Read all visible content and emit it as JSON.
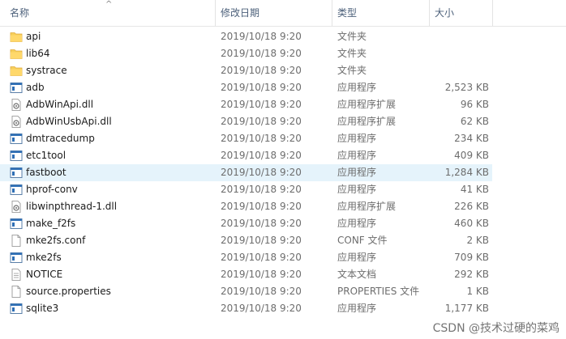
{
  "header": {
    "name": "名称",
    "date": "修改日期",
    "type": "类型",
    "size": "大小",
    "sort_arrow": "^"
  },
  "rows": [
    {
      "name": "api",
      "date": "2019/10/18 9:20",
      "type": "文件夹",
      "size": "",
      "icon": "folder-icon"
    },
    {
      "name": "lib64",
      "date": "2019/10/18 9:20",
      "type": "文件夹",
      "size": "",
      "icon": "folder-icon"
    },
    {
      "name": "systrace",
      "date": "2019/10/18 9:20",
      "type": "文件夹",
      "size": "",
      "icon": "folder-icon"
    },
    {
      "name": "adb",
      "date": "2019/10/18 9:20",
      "type": "应用程序",
      "size": "2,523 KB",
      "icon": "application-icon"
    },
    {
      "name": "AdbWinApi.dll",
      "date": "2019/10/18 9:20",
      "type": "应用程序扩展",
      "size": "96 KB",
      "icon": "dll-icon"
    },
    {
      "name": "AdbWinUsbApi.dll",
      "date": "2019/10/18 9:20",
      "type": "应用程序扩展",
      "size": "62 KB",
      "icon": "dll-icon"
    },
    {
      "name": "dmtracedump",
      "date": "2019/10/18 9:20",
      "type": "应用程序",
      "size": "234 KB",
      "icon": "application-icon"
    },
    {
      "name": "etc1tool",
      "date": "2019/10/18 9:20",
      "type": "应用程序",
      "size": "409 KB",
      "icon": "application-icon"
    },
    {
      "name": "fastboot",
      "date": "2019/10/18 9:20",
      "type": "应用程序",
      "size": "1,284 KB",
      "icon": "application-icon",
      "selected": true
    },
    {
      "name": "hprof-conv",
      "date": "2019/10/18 9:20",
      "type": "应用程序",
      "size": "41 KB",
      "icon": "application-icon"
    },
    {
      "name": "libwinpthread-1.dll",
      "date": "2019/10/18 9:20",
      "type": "应用程序扩展",
      "size": "226 KB",
      "icon": "dll-icon"
    },
    {
      "name": "make_f2fs",
      "date": "2019/10/18 9:20",
      "type": "应用程序",
      "size": "460 KB",
      "icon": "application-icon"
    },
    {
      "name": "mke2fs.conf",
      "date": "2019/10/18 9:20",
      "type": "CONF 文件",
      "size": "2 KB",
      "icon": "file-icon"
    },
    {
      "name": "mke2fs",
      "date": "2019/10/18 9:20",
      "type": "应用程序",
      "size": "709 KB",
      "icon": "application-icon"
    },
    {
      "name": "NOTICE",
      "date": "2019/10/18 9:20",
      "type": "文本文档",
      "size": "292 KB",
      "icon": "text-file-icon"
    },
    {
      "name": "source.properties",
      "date": "2019/10/18 9:20",
      "type": "PROPERTIES 文件",
      "size": "1 KB",
      "icon": "file-icon"
    },
    {
      "name": "sqlite3",
      "date": "2019/10/18 9:20",
      "type": "应用程序",
      "size": "1,177 KB",
      "icon": "application-icon"
    }
  ],
  "watermark": "CSDN @技术过硬的菜鸡"
}
